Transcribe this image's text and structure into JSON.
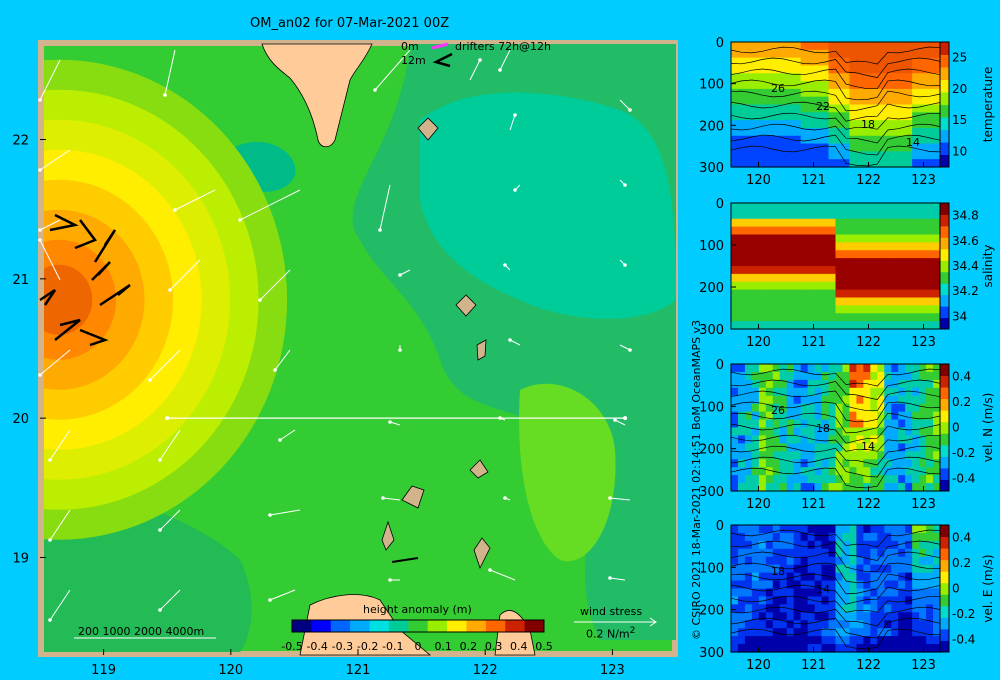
{
  "title": "OM_an02 for 07-Mar-2021 00Z",
  "credit": "© CSIRO 2021  18-Mar-2021 02:14:51 BoM OceanMAPS v3",
  "drifters": {
    "depth_0": "0m",
    "depth_12": "12m",
    "label": "drifters 72h@12h",
    "color": "#ff33ff"
  },
  "depth_legend": "200  1000  2000  4000m",
  "wind": {
    "label": "wind stress",
    "scale": "0.2 N/m",
    "scale_sup": "2"
  },
  "chart_data": [
    {
      "type": "heatmap",
      "name": "map",
      "xlabel": "",
      "ylabel": "",
      "xlim": [
        118.5,
        123.5
      ],
      "ylim": [
        18.3,
        22.7
      ],
      "xticks": [
        119,
        120,
        121,
        122,
        123
      ],
      "yticks": [
        19,
        20,
        21,
        22
      ],
      "colorbar": {
        "title": "height anomaly (m)",
        "range": [
          -0.5,
          0.5
        ],
        "ticks": [
          "-0.5",
          "-0.4",
          "-0.3",
          "-0.2",
          "-0.1",
          "0",
          "0.1",
          "0.2",
          "0.3",
          "0.4",
          "0.5"
        ],
        "colors": [
          "#000080",
          "#0000ff",
          "#0066ff",
          "#00aaff",
          "#00e0e0",
          "#00cc99",
          "#33cc33",
          "#99ee00",
          "#ffee00",
          "#ffaa00",
          "#ff6600",
          "#cc2200",
          "#800000"
        ]
      },
      "anomaly_field": {
        "peak_center": [
          118.65,
          20.85
        ],
        "peak_value": 0.4,
        "levels": [
          0.35,
          0.3,
          0.25,
          0.2,
          0.15,
          0.1,
          0.05
        ],
        "background_value": 0.0
      },
      "section_line": {
        "from": [
          119.5,
          20.0
        ],
        "to": [
          123.1,
          20.0
        ]
      }
    },
    {
      "type": "heatmap",
      "name": "temperature section",
      "ylabel": "",
      "colorbar_label": "temperature",
      "xlim": [
        119.5,
        123.3
      ],
      "ylim": [
        300,
        0
      ],
      "xticks": [
        120,
        121,
        122,
        123
      ],
      "yticks": [
        0,
        100,
        200,
        300
      ],
      "cbar_ticks": [
        "25",
        "20",
        "15",
        "10"
      ],
      "contour_labels": [
        "26",
        "22",
        "18",
        "14"
      ]
    },
    {
      "type": "heatmap",
      "name": "salinity section",
      "ylabel": "",
      "colorbar_label": "salinity",
      "xlim": [
        119.5,
        123.3
      ],
      "ylim": [
        300,
        0
      ],
      "xticks": [
        120,
        121,
        122,
        123
      ],
      "yticks": [
        0,
        100,
        200,
        300
      ],
      "cbar_ticks": [
        "34.8",
        "34.6",
        "34.4",
        "34.2",
        "34"
      ]
    },
    {
      "type": "heatmap",
      "name": "north velocity section",
      "ylabel": "",
      "colorbar_label": "vel. N (m/s)",
      "xlim": [
        119.5,
        123.3
      ],
      "ylim": [
        300,
        0
      ],
      "xticks": [
        120,
        121,
        122,
        123
      ],
      "yticks": [
        0,
        100,
        200,
        300
      ],
      "cbar_ticks": [
        "0.4",
        "0.2",
        "0",
        "-0.2",
        "-0.4"
      ],
      "contour_labels": [
        "26",
        "18",
        "14"
      ]
    },
    {
      "type": "heatmap",
      "name": "east velocity section",
      "ylabel": "",
      "colorbar_label": "vel. E (m/s)",
      "xlim": [
        119.5,
        123.3
      ],
      "ylim": [
        300,
        0
      ],
      "xticks": [
        120,
        121,
        122,
        123
      ],
      "yticks": [
        0,
        100,
        200,
        300
      ],
      "cbar_ticks": [
        "0.4",
        "0.2",
        "0",
        "-0.2",
        "-0.4"
      ],
      "contour_labels": [
        "18",
        "14"
      ]
    }
  ]
}
